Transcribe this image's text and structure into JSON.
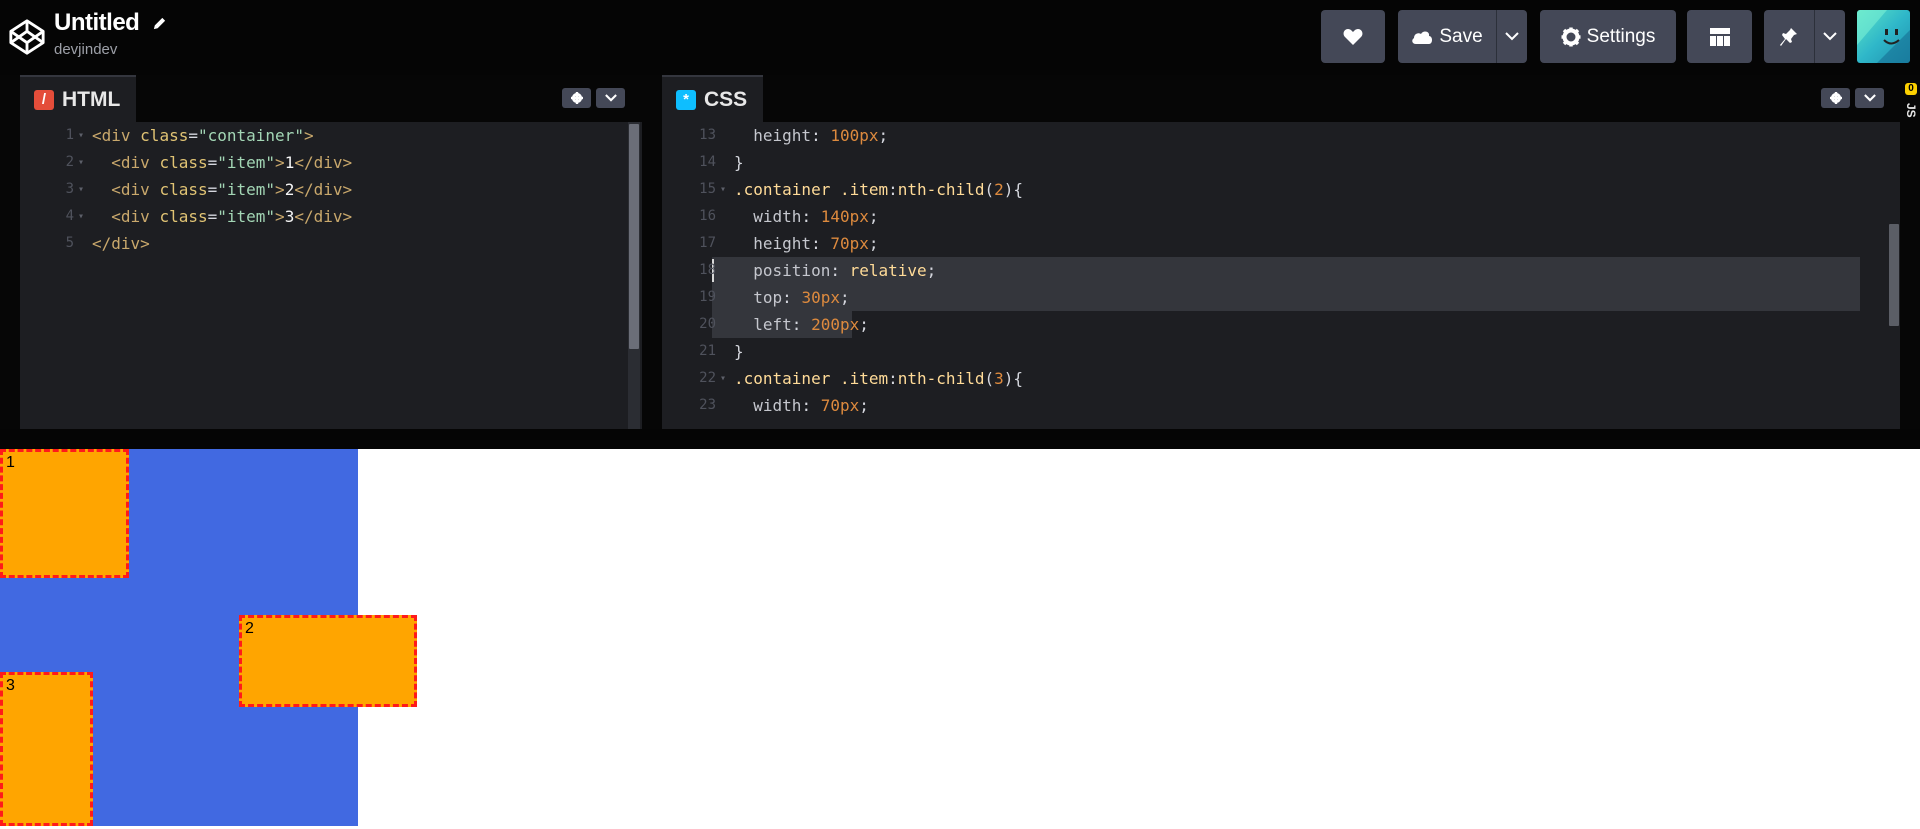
{
  "header": {
    "title": "Untitled",
    "username": "devjindev",
    "save_label": "Save",
    "settings_label": "Settings"
  },
  "html_pane": {
    "tab_label": "HTML",
    "badge_icon": "/",
    "lines": [
      {
        "num": "1",
        "fold": "▾",
        "tokens": [
          [
            "t-tag",
            "<div "
          ],
          [
            "t-attr",
            "class"
          ],
          [
            "t-p",
            "="
          ],
          [
            "t-str",
            "\"container\""
          ],
          [
            "t-tag",
            ">"
          ]
        ]
      },
      {
        "num": "2",
        "fold": "▾",
        "tokens": [
          [
            "t-tag",
            "  <div "
          ],
          [
            "t-attr",
            "class"
          ],
          [
            "t-p",
            "="
          ],
          [
            "t-str",
            "\"item\""
          ],
          [
            "t-tag",
            ">"
          ],
          [
            "t-text",
            "1"
          ],
          [
            "t-tag",
            "</div>"
          ]
        ]
      },
      {
        "num": "3",
        "fold": "▾",
        "tokens": [
          [
            "t-tag",
            "  <div "
          ],
          [
            "t-attr",
            "class"
          ],
          [
            "t-p",
            "="
          ],
          [
            "t-str",
            "\"item\""
          ],
          [
            "t-tag",
            ">"
          ],
          [
            "t-text",
            "2"
          ],
          [
            "t-tag",
            "</div>"
          ]
        ]
      },
      {
        "num": "4",
        "fold": "▾",
        "tokens": [
          [
            "t-tag",
            "  <div "
          ],
          [
            "t-attr",
            "class"
          ],
          [
            "t-p",
            "="
          ],
          [
            "t-str",
            "\"item\""
          ],
          [
            "t-tag",
            ">"
          ],
          [
            "t-text",
            "3"
          ],
          [
            "t-tag",
            "</div>"
          ]
        ]
      },
      {
        "num": "5",
        "fold": "",
        "tokens": [
          [
            "t-tag",
            "</div>"
          ]
        ]
      }
    ]
  },
  "css_pane": {
    "tab_label": "CSS",
    "badge_icon": "*",
    "lines": [
      {
        "num": "13",
        "fold": "",
        "tokens": [
          [
            "t-prop",
            "  height"
          ],
          [
            "t-p",
            ": "
          ],
          [
            "t-num",
            "100px"
          ],
          [
            "t-p",
            ";"
          ]
        ]
      },
      {
        "num": "14",
        "fold": "",
        "tokens": [
          [
            "t-p",
            "}"
          ]
        ]
      },
      {
        "num": "15",
        "fold": "▾",
        "tokens": [
          [
            "t-sel",
            ".container .item"
          ],
          [
            "t-p",
            ":"
          ],
          [
            "t-sel",
            "nth-child"
          ],
          [
            "t-p",
            "("
          ],
          [
            "t-num",
            "2"
          ],
          [
            "t-p",
            "){"
          ]
        ]
      },
      {
        "num": "16",
        "fold": "",
        "tokens": [
          [
            "t-prop",
            "  width"
          ],
          [
            "t-p",
            ": "
          ],
          [
            "t-num",
            "140px"
          ],
          [
            "t-p",
            ";"
          ]
        ]
      },
      {
        "num": "17",
        "fold": "",
        "tokens": [
          [
            "t-prop",
            "  height"
          ],
          [
            "t-p",
            ": "
          ],
          [
            "t-num",
            "70px"
          ],
          [
            "t-p",
            ";"
          ]
        ]
      },
      {
        "num": "18",
        "fold": "",
        "tokens": [
          [
            "t-prop",
            "  position"
          ],
          [
            "t-p",
            ": "
          ],
          [
            "t-kw",
            "relative"
          ],
          [
            "t-p",
            ";"
          ]
        ]
      },
      {
        "num": "19",
        "fold": "",
        "tokens": [
          [
            "t-prop",
            "  top"
          ],
          [
            "t-p",
            ": "
          ],
          [
            "t-num",
            "30px"
          ],
          [
            "t-p",
            ";"
          ]
        ]
      },
      {
        "num": "20",
        "fold": "",
        "tokens": [
          [
            "t-prop",
            "  left"
          ],
          [
            "t-p",
            ": "
          ],
          [
            "t-num",
            "200px"
          ],
          [
            "t-p",
            ";"
          ]
        ]
      },
      {
        "num": "21",
        "fold": "",
        "tokens": [
          [
            "t-p",
            "}"
          ]
        ]
      },
      {
        "num": "22",
        "fold": "▾",
        "tokens": [
          [
            "t-sel",
            ".container .item"
          ],
          [
            "t-p",
            ":"
          ],
          [
            "t-sel",
            "nth-child"
          ],
          [
            "t-p",
            "("
          ],
          [
            "t-num",
            "3"
          ],
          [
            "t-p",
            "){"
          ]
        ]
      },
      {
        "num": "23",
        "fold": "",
        "tokens": [
          [
            "t-prop",
            "  width"
          ],
          [
            "t-p",
            ": "
          ],
          [
            "t-num",
            "70px"
          ],
          [
            "t-p",
            ";"
          ]
        ]
      }
    ]
  },
  "js_collapsed": {
    "label": "JS",
    "count": "0"
  },
  "preview": {
    "items": [
      "1",
      "2",
      "3"
    ]
  },
  "colors": {
    "header_bg": "#050505",
    "button_bg": "#444857",
    "editor_bg": "#1d1e22",
    "container_bg": "#4169e1",
    "item_bg": "#ffa500",
    "item_border": "#ff1a1a",
    "html_badge": "#e44d3a",
    "css_badge": "#0ebeff",
    "js_badge": "#fcd000"
  },
  "icons": {
    "logo": "codepen-logo-icon",
    "pencil": "pencil-icon",
    "heart": "heart-icon",
    "cloud": "cloud-icon",
    "gear": "gear-icon",
    "layout": "layout-grid-icon",
    "pin": "pin-icon",
    "chevron": "chevron-down-icon"
  }
}
